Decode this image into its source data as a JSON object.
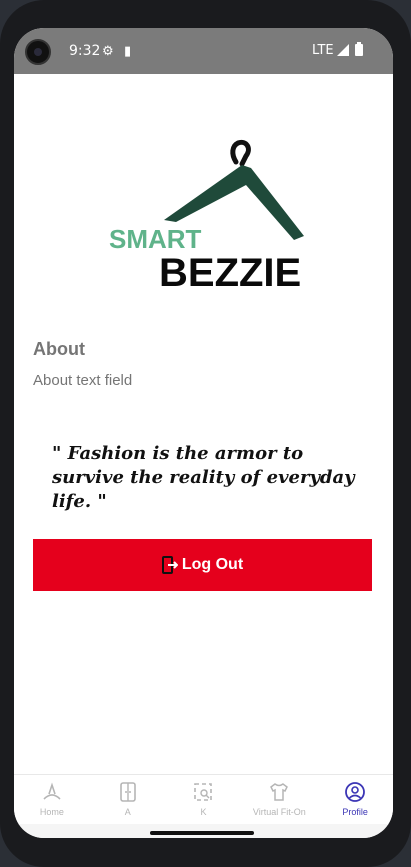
{
  "status_bar": {
    "time": "9:32",
    "network": "LTE"
  },
  "logo": {
    "word1": "SMART",
    "word2": "BEZZIE"
  },
  "about": {
    "title": "About",
    "text": "About text field"
  },
  "quote": "\" Fashion is the armor to survive the reality of everyday life. \"",
  "logout": {
    "label": "Log Out"
  },
  "nav": [
    {
      "label": "Home",
      "icon": "home-icon"
    },
    {
      "label": "A",
      "icon": "wardrobe-icon"
    },
    {
      "label": "K",
      "icon": "scan-icon"
    },
    {
      "label": "Virtual Fit-On",
      "icon": "tshirt-icon"
    },
    {
      "label": "Profile",
      "icon": "profile-icon"
    }
  ],
  "colors": {
    "accent": "#e5001c",
    "nav_active": "#3b35b5",
    "logo_green": "#5fb38a",
    "hanger_dark": "#1f4a3a"
  }
}
